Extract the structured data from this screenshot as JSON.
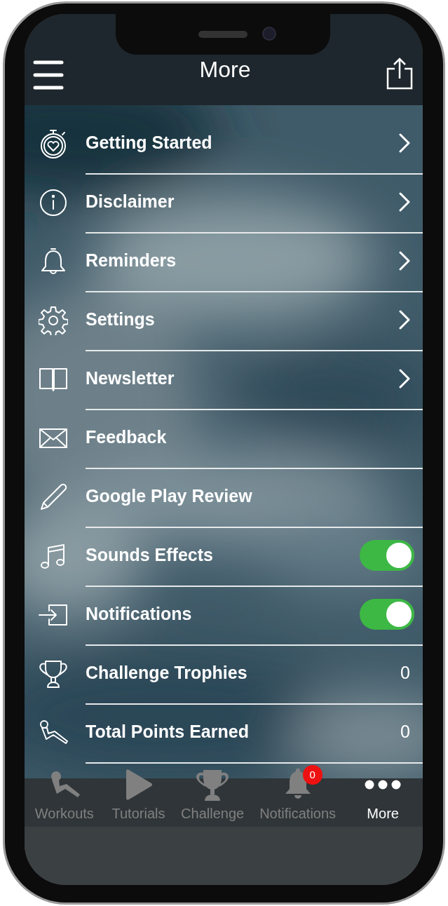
{
  "header": {
    "title": "More"
  },
  "menu": [
    {
      "label": "Getting Started",
      "kind": "link"
    },
    {
      "label": "Disclaimer",
      "kind": "link"
    },
    {
      "label": "Reminders",
      "kind": "link"
    },
    {
      "label": "Settings",
      "kind": "link"
    },
    {
      "label": "Newsletter",
      "kind": "link"
    },
    {
      "label": "Feedback",
      "kind": "action"
    },
    {
      "label": "Google Play Review",
      "kind": "action"
    },
    {
      "label": "Sounds Effects",
      "kind": "toggle",
      "on": true
    },
    {
      "label": "Notifications",
      "kind": "toggle",
      "on": true
    },
    {
      "label": "Challenge Trophies",
      "kind": "value",
      "value": "0"
    },
    {
      "label": "Total Points Earned",
      "kind": "value",
      "value": "0"
    }
  ],
  "tab_bar": [
    {
      "label": "Workouts",
      "selected": false
    },
    {
      "label": "Tutorials",
      "selected": false
    },
    {
      "label": "Challenge",
      "selected": false
    },
    {
      "label": "Notifications",
      "selected": false,
      "badge": "0"
    },
    {
      "label": "More",
      "selected": true
    }
  ]
}
